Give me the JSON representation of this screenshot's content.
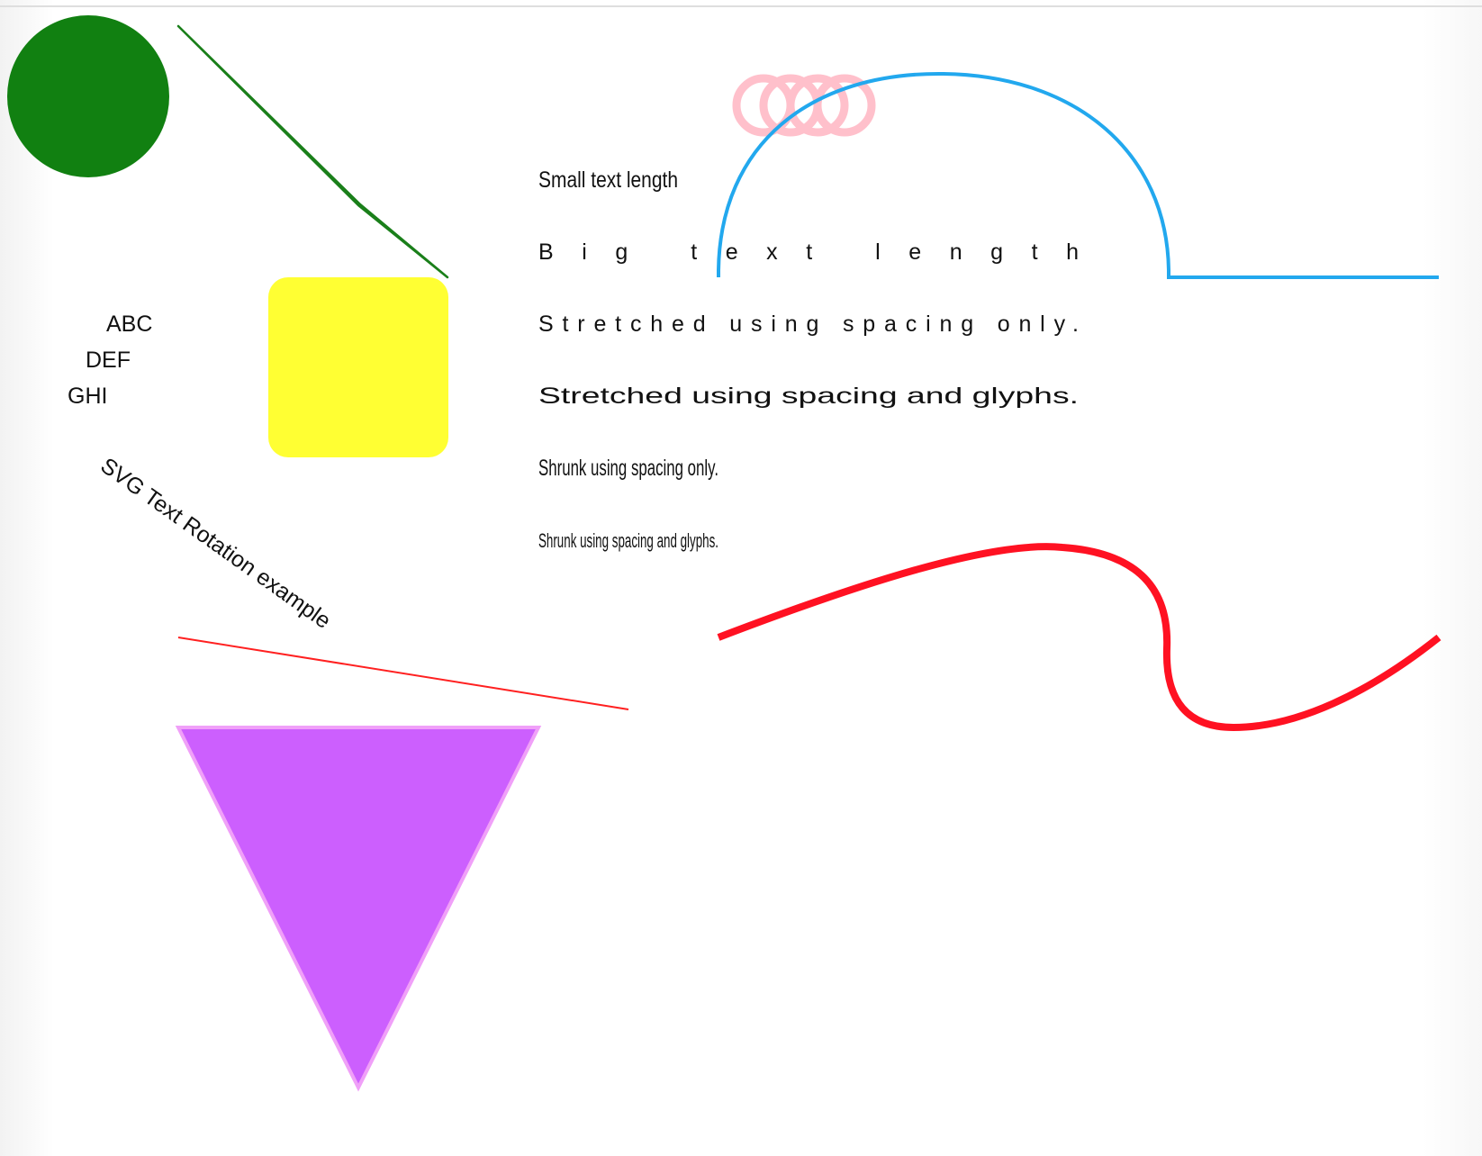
{
  "colors": {
    "circle_fill": "#118011",
    "diagonal_stroke": "#1a7f1a",
    "diagonal_fill": "#f0a020",
    "square_fill": "#ffff33",
    "rings_stroke": "#ffc0cb",
    "arc_stroke": "#22a8ee",
    "wave_stroke": "#ff1122",
    "thin_line_stroke": "#ff2020",
    "triangle_fill": "#cc5ffe",
    "triangle_stroke": "#f0a0f8"
  },
  "labels": {
    "abc": "ABC",
    "def": "DEF",
    "ghi": "GHI",
    "rotated": "SVG Text Rotation example",
    "small_text_length": "Small text length",
    "big_text_length": "Big text length",
    "stretched_spacing": "Stretched using spacing only.",
    "stretched_glyphs": "Stretched using spacing and glyphs.",
    "shrunk_spacing": "Shrunk using spacing only.",
    "shrunk_glyphs": "Shrunk using spacing and glyphs."
  }
}
